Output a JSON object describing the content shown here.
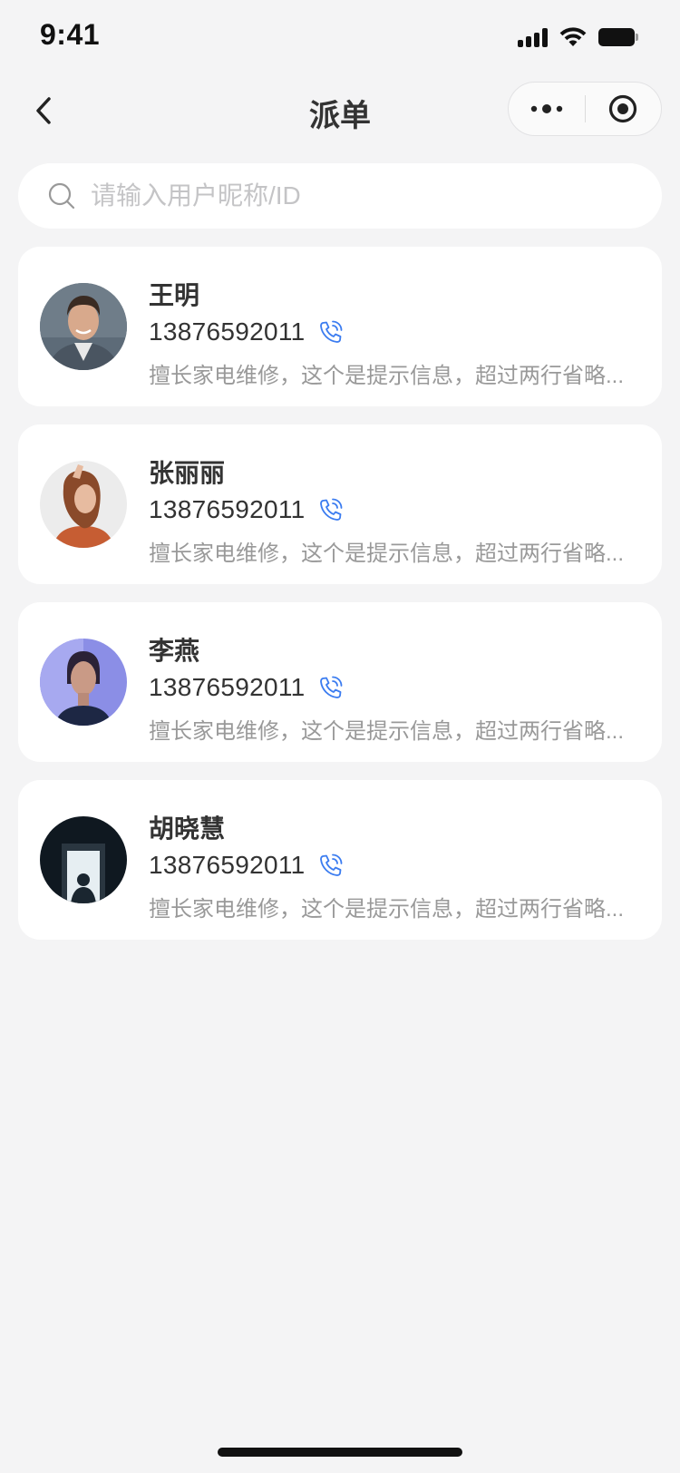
{
  "status_bar": {
    "time": "9:41"
  },
  "nav": {
    "title": "派单",
    "back_icon": "chevron-left-icon",
    "more_icon": "more-dots-icon",
    "close_icon": "target-circle-icon"
  },
  "search": {
    "placeholder": "请输入用户昵称/ID",
    "value": ""
  },
  "workers": [
    {
      "name": "王明",
      "phone": "13876592011",
      "desc": "擅长家电维修，这个是提示信息，超过两行省略..."
    },
    {
      "name": "张丽丽",
      "phone": "13876592011",
      "desc": "擅长家电维修，这个是提示信息，超过两行省略..."
    },
    {
      "name": "李燕",
      "phone": "13876592011",
      "desc": "擅长家电维修，这个是提示信息，超过两行省略..."
    },
    {
      "name": "胡晓慧",
      "phone": "13876592011",
      "desc": "擅长家电维修，这个是提示信息，超过两行省略..."
    }
  ],
  "colors": {
    "background": "#f4f4f5",
    "accent_phone": "#3b7cf0",
    "card": "#ffffff",
    "muted_text": "#999999"
  }
}
